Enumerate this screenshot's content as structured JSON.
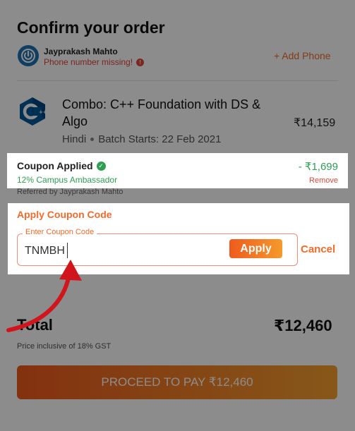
{
  "header": {
    "title": "Confirm your order"
  },
  "user": {
    "name": "Jayprakash Mahto",
    "phone_status": "Phone number missing!",
    "add_phone_label": "+ Add Phone"
  },
  "course": {
    "title": "Combo: C++ Foundation with DS & Algo",
    "price": "₹14,159",
    "language": "Hindi",
    "batch": "Batch Starts: 22 Feb 2021"
  },
  "coupon": {
    "status": "Coupon Applied",
    "type": "12% Campus Ambassador",
    "discount": "- ₹1,699",
    "remove_label": "Remove",
    "referred": "Referred by Jayprakash Mahto"
  },
  "apply_coupon": {
    "heading": "Apply Coupon Code",
    "field_label": "Enter Coupon Code",
    "value": "TNMBH",
    "apply_label": "Apply",
    "cancel_label": "Cancel"
  },
  "summary": {
    "total_label": "Total",
    "total_value": "₹12,460",
    "tax_note": "Price inclusive of 18% GST",
    "proceed_label": "PROCEED TO PAY ₹12,460"
  },
  "colors": {
    "accent": "#f26b2b",
    "success": "#2e9e52",
    "error": "#e0463a",
    "annotation_arrow": "#d0161c"
  },
  "icons": [
    "power-icon",
    "warning-icon",
    "cpp-logo-icon",
    "check-circle-icon",
    "annotation-arrow"
  ]
}
